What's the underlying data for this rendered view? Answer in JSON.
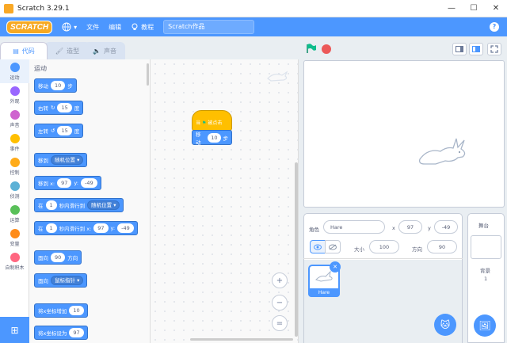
{
  "window": {
    "title": "Scratch 3.29.1",
    "minimize": "—",
    "maximize": "☐",
    "close": "✕"
  },
  "menu": {
    "logo": "SCRATCH",
    "globe_caret": "▾",
    "file": "文件",
    "edit": "编辑",
    "tutorials": "教程",
    "project_name": "Scratch作品",
    "help": "?"
  },
  "tabs": {
    "code": "代码",
    "costumes": "造型",
    "sounds": "声音"
  },
  "categories": [
    {
      "label": "运动",
      "color": "#4c97ff"
    },
    {
      "label": "外观",
      "color": "#9966ff"
    },
    {
      "label": "声音",
      "color": "#cf63cf"
    },
    {
      "label": "事件",
      "color": "#ffbf00"
    },
    {
      "label": "控制",
      "color": "#ffab19"
    },
    {
      "label": "侦测",
      "color": "#5cb1d6"
    },
    {
      "label": "运算",
      "color": "#59c059"
    },
    {
      "label": "变量",
      "color": "#ff8c1a"
    },
    {
      "label": "自制积木",
      "color": "#ff6680"
    }
  ],
  "palette": {
    "heading": "运动",
    "move": {
      "a": "移动",
      "v": "10",
      "b": "步"
    },
    "turn_right": {
      "a": "右转",
      "icon": "↻",
      "v": "15",
      "b": "度"
    },
    "turn_left": {
      "a": "左转",
      "icon": "↺",
      "v": "15",
      "b": "度"
    },
    "goto": {
      "a": "移到",
      "dd": "随机位置 ▾"
    },
    "goto_xy": {
      "a": "移到 x:",
      "x": "97",
      "yl": "y:",
      "y": "-49"
    },
    "glide": {
      "a": "在",
      "v": "1",
      "b": "秒内滑行到",
      "dd": "随机位置 ▾"
    },
    "glide_xy": {
      "a": "在",
      "v": "1",
      "b": "秒内滑行到 x:",
      "x": "97",
      "yl": "y:",
      "y": "-49"
    },
    "point_dir": {
      "a": "面向",
      "v": "90",
      "b": "方向"
    },
    "point_towards": {
      "a": "面向",
      "dd": "鼠标指针 ▾"
    },
    "change_x": {
      "a": "将x坐标增加",
      "v": "10"
    },
    "set_x": {
      "a": "将x坐标设为",
      "v": "97"
    }
  },
  "script": {
    "when": "当",
    "flag": "⚑",
    "clicked": "被点击",
    "move": "移动",
    "v": "10",
    "steps": "步"
  },
  "zoom": {
    "in": "+",
    "out": "−",
    "reset": "="
  },
  "sprite": {
    "label": "角色",
    "name": "Hare",
    "x_label": "x",
    "x": "97",
    "y_label": "y",
    "y": "-49",
    "show_label": "显示",
    "size_label": "大小",
    "size": "100",
    "direction_label": "方向",
    "direction": "90",
    "thumb_name": "Hare",
    "delete": "✕",
    "add": "🐱"
  },
  "stage_pane": {
    "title": "舞台",
    "backdrops_label": "背景",
    "backdrops_count": "1",
    "add": "🖼"
  },
  "colors": {
    "accent": "#4c97ff",
    "events": "#ffbf00",
    "flag": "#0fbd8c",
    "stop": "#ec5959"
  }
}
